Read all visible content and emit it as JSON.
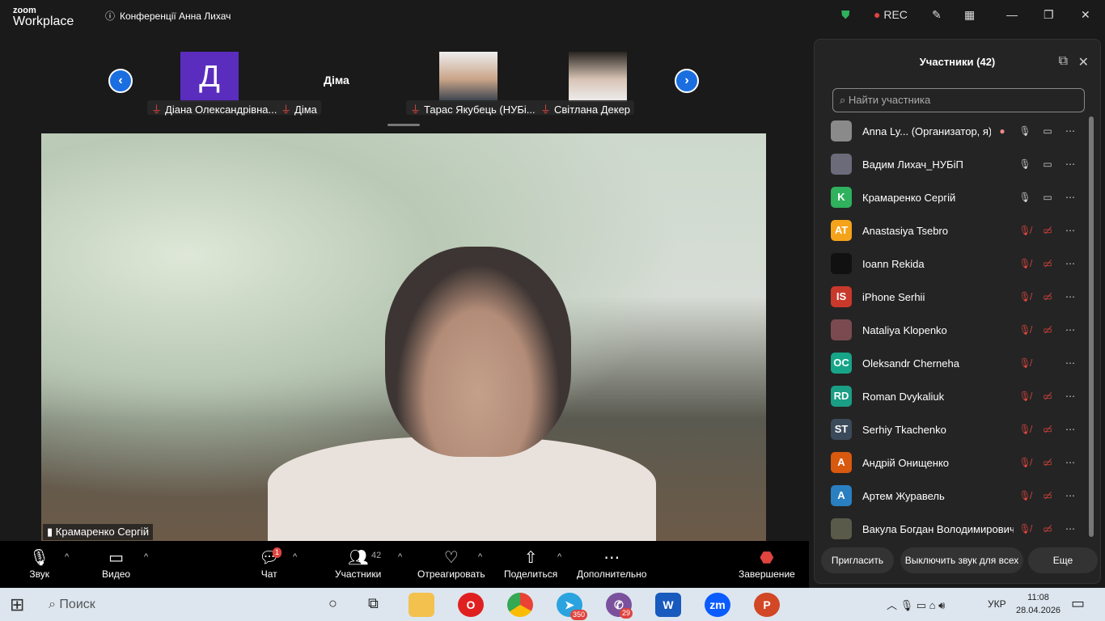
{
  "app": {
    "logo_top": "zoom",
    "logo_bottom": "Workplace",
    "title": "Конференції Анна Лихач",
    "rec": "REC"
  },
  "gallery": {
    "tiles": [
      {
        "initial": "Д",
        "name": "Діана Олександрівна..."
      },
      {
        "name": "Діма",
        "label": "Діма"
      },
      {
        "name": "Тарас Якубець (НУБі..."
      },
      {
        "name": "Світлана Декер"
      }
    ]
  },
  "video": {
    "speaker": "Крамаренко Сергій"
  },
  "toolbar": {
    "audio": "Звук",
    "video": "Видео",
    "chat": "Чат",
    "chat_badge": "1",
    "participants": "Участники",
    "participants_count": "42",
    "react": "Отреагировать",
    "share": "Поделиться",
    "more": "Дополнительно",
    "end": "Завершение"
  },
  "panel": {
    "title": "Участники (42)",
    "search_placeholder": "Найти участника",
    "participants": [
      {
        "initials": "",
        "name": "Anna Ly...  (Организатор, я)",
        "color": "#8a8a8a",
        "mic": "on",
        "cam": "on"
      },
      {
        "initials": "",
        "name": "Вадим Лихач_НУБіП",
        "color": "#6b6b7a",
        "mic": "on",
        "cam": "on"
      },
      {
        "initials": "K",
        "name": "Крамаренко Сергій",
        "color": "#2fb15d",
        "mic": "talking",
        "cam": "on"
      },
      {
        "initials": "AT",
        "name": "Anastasiya Tsebro",
        "color": "#f5a31a",
        "mic": "muted",
        "cam": "off"
      },
      {
        "initials": "",
        "name": "Ioann Rekida",
        "color": "#111111",
        "mic": "muted",
        "cam": "off"
      },
      {
        "initials": "IS",
        "name": "iPhone Serhii",
        "color": "#c8392b",
        "mic": "muted",
        "cam": "off"
      },
      {
        "initials": "",
        "name": "Nataliya Klopenko",
        "color": "#7a4a50",
        "mic": "muted",
        "cam": "off"
      },
      {
        "initials": "OC",
        "name": "Oleksandr Cherneha",
        "color": "#17a589",
        "mic": "muted",
        "cam": "none"
      },
      {
        "initials": "RD",
        "name": "Roman Dvykaliuk",
        "color": "#1a9e85",
        "mic": "muted",
        "cam": "off"
      },
      {
        "initials": "ST",
        "name": "Serhiy Tkachenko",
        "color": "#3b4a5a",
        "mic": "muted",
        "cam": "off"
      },
      {
        "initials": "A",
        "name": "Андрій Онищенко",
        "color": "#d9590f",
        "mic": "muted",
        "cam": "off"
      },
      {
        "initials": "A",
        "name": "Артем Журавель",
        "color": "#2a7fc0",
        "mic": "muted",
        "cam": "off"
      },
      {
        "initials": "",
        "name": "Вакула Богдан Володимирович",
        "color": "#5a5a4a",
        "mic": "muted",
        "cam": "off"
      }
    ],
    "invite": "Пригласить",
    "mute_all": "Выключить звук для всех",
    "more": "Еще"
  },
  "taskbar": {
    "search": "Поиск",
    "telegram_badge": "350",
    "viber_badge": "29",
    "lang": "УКР",
    "time": "11:08",
    "date": "28.04.2026"
  }
}
